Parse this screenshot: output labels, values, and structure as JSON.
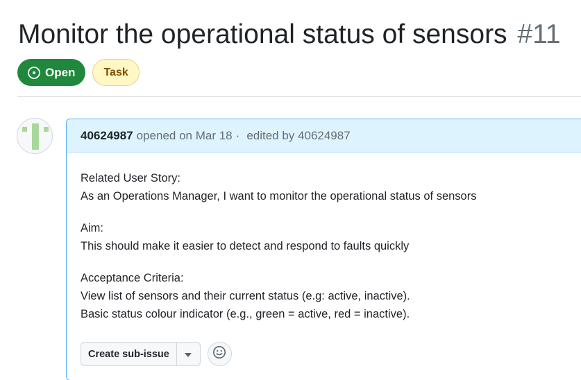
{
  "issue": {
    "title": "Monitor the operational status of sensors",
    "number": "#11",
    "state_label": "Open",
    "state_icon": "issue-opened-icon",
    "type_label": "Task"
  },
  "comment": {
    "author": "40624987",
    "opened_text": "opened on Mar 18",
    "separator": "·",
    "edited_text": "edited by 40624987",
    "body": {
      "story_heading": "Related User Story:",
      "story_text": "As an Operations Manager, I want to monitor the operational status of sensors",
      "aim_heading": "Aim:",
      "aim_text": "This should make it easier to detect and respond to faults quickly",
      "criteria_heading": "Acceptance Criteria:",
      "criteria_line1": "View list of sensors and their current status (e.g: active, inactive).",
      "criteria_line2": "Basic status colour indicator (e.g., green = active, red = inactive)."
    }
  },
  "actions": {
    "create_sub_issue_label": "Create sub-issue",
    "caret_icon": "triangle-down-icon",
    "emoji_icon": "smiley-icon"
  },
  "colors": {
    "open_green": "#1f883d",
    "task_yellow": "#fff8c5",
    "header_blue": "#ddf4ff",
    "border_blue": "#54aeff",
    "avatar_green": "#a8d99a"
  }
}
